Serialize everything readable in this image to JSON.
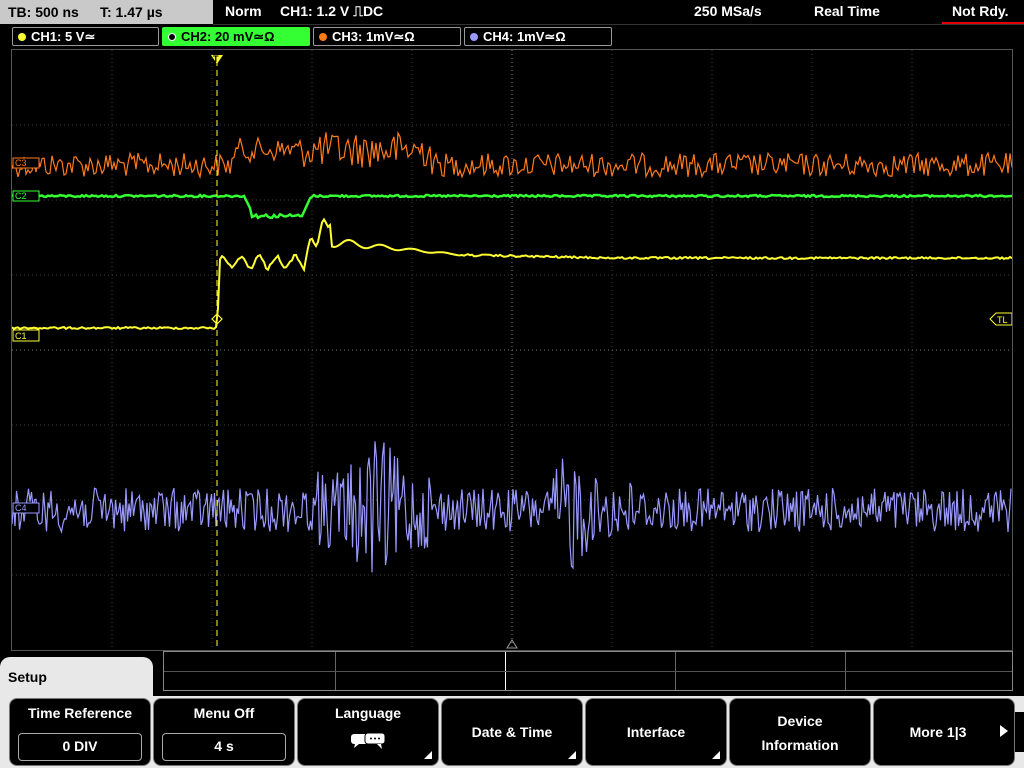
{
  "status": {
    "timebase": "TB: 500 ns",
    "trigger_time": "T: 1.47 µs",
    "acq_mode": "Norm",
    "trigger_info": "CH1: 1.2 V ⎍DC",
    "sample_rate": "250 MSa/s",
    "mode": "Real Time",
    "ready_state": "Not Rdy."
  },
  "channels": [
    {
      "label": "CH1: 5 V≃",
      "color": "#ffff33"
    },
    {
      "label": "CH2: 20 mV≃Ω",
      "color": "#33ff33"
    },
    {
      "label": "CH3: 1mV≃Ω",
      "color": "#ff7a1a"
    },
    {
      "label": "CH4: 1mV≃Ω",
      "color": "#9999ff"
    }
  ],
  "markers": {
    "trigger": "T",
    "trigger_level": "TL",
    "ch1": "C1",
    "ch2": "C2",
    "ch3": "C3",
    "ch4": "C4"
  },
  "menu": {
    "title": "Setup",
    "softkeys": [
      {
        "label": "Time Reference",
        "value": "0 DIV"
      },
      {
        "label": "Menu Off",
        "value": "4 s"
      },
      {
        "label": "Language",
        "icon": "speech-bubble-icon"
      },
      {
        "label": "Date & Time"
      },
      {
        "label": "Interface"
      },
      {
        "label_line1": "Device",
        "label_line2": "Information"
      },
      {
        "label": "More 1|3"
      }
    ]
  },
  "colors": {
    "ch1": "#ffff33",
    "ch2": "#33ff33",
    "ch3": "#ff7a1a",
    "ch4": "#9999ff",
    "grid": "#666666",
    "ready_alert": "#e00000"
  }
}
